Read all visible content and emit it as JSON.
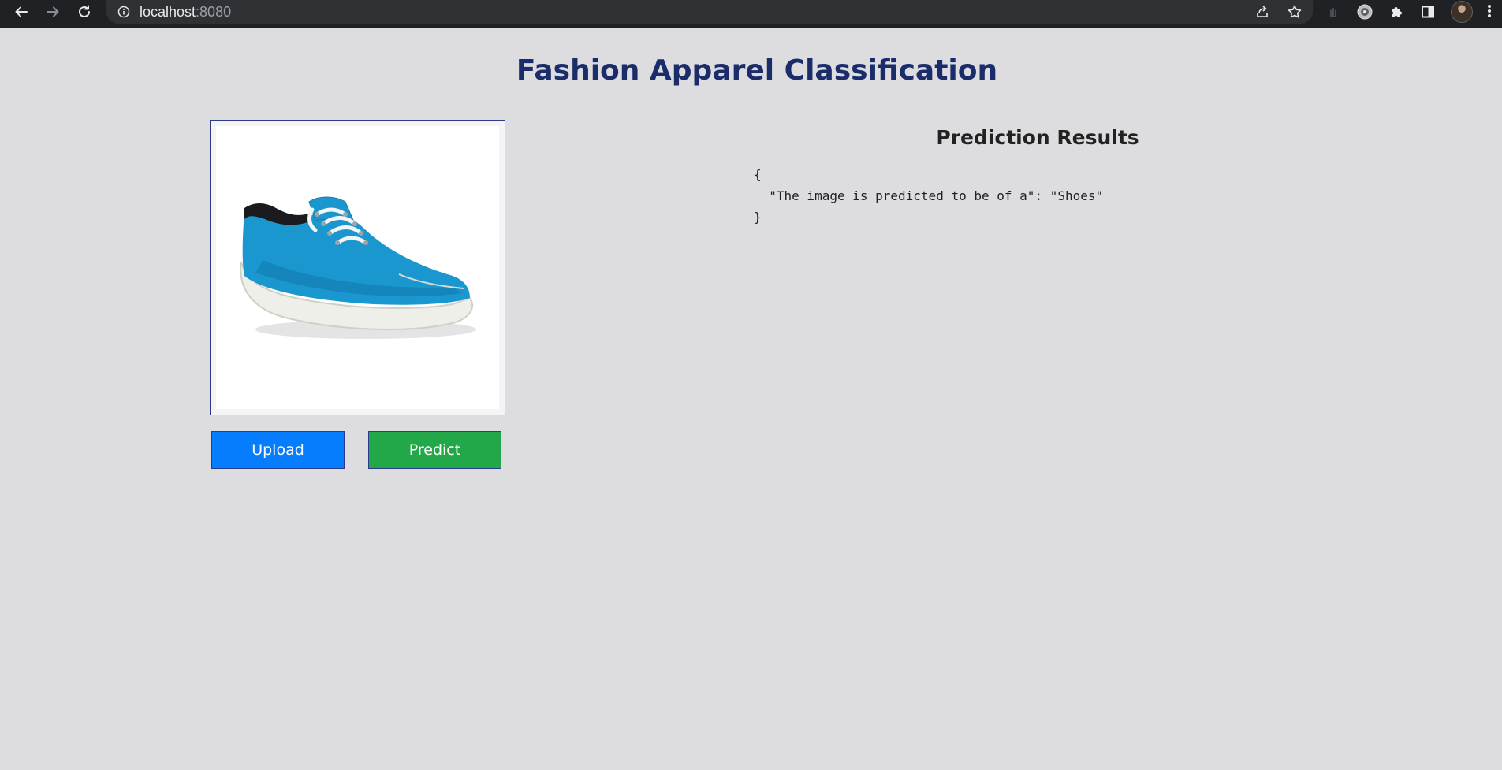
{
  "browser": {
    "url_host": "localhost",
    "url_port": ":8080",
    "icons": {
      "back": "arrow-left-icon",
      "forward": "arrow-right-icon",
      "reload": "reload-icon",
      "site_info": "info-icon",
      "share": "share-icon",
      "bookmark": "star-icon",
      "extension_1": "hand-extension-icon",
      "extension_2": "extension-icon",
      "extensions_menu": "puzzle-icon",
      "side_panel": "side-panel-icon",
      "profile": "avatar",
      "menu": "kebab-menu-icon"
    }
  },
  "page": {
    "title": "Fashion Apparel Classification",
    "preview_image": {
      "subject": "blue canvas sneaker with white laces and white sole"
    },
    "buttons": {
      "upload": "Upload",
      "predict": "Predict"
    },
    "results": {
      "heading": "Prediction Results",
      "open_brace": "{",
      "line": "  \"The image is predicted to be of a\": \"Shoes\"",
      "close_brace": "}"
    }
  },
  "colors": {
    "page_background": "#dddde0",
    "title": "#1b2c6b",
    "upload_button": "#067dfc",
    "predict_button": "#22a849",
    "frame_border": "#2b3a8a"
  }
}
